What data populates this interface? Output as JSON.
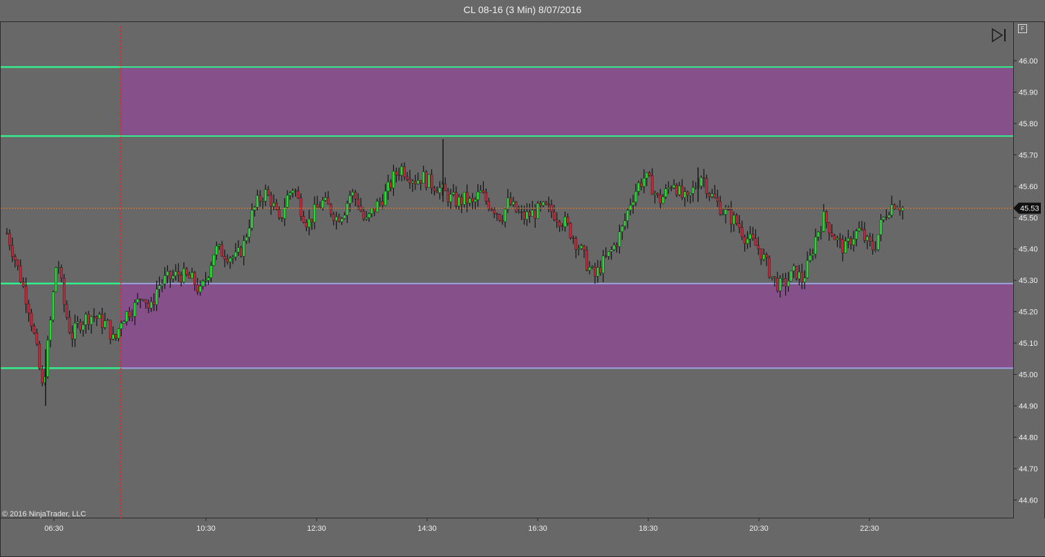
{
  "window": {
    "title": "CL 08-16 (3 Min)  8/07/2016"
  },
  "copyright": "© 2016 NinjaTrader, LLC",
  "buttons": {
    "f_label": "F"
  },
  "icons": [
    "skip-to-end-icon"
  ],
  "colors": {
    "background": "#686868",
    "up_bar": "#1ee02d",
    "down_bar": "#c0283a",
    "wick": "#111111",
    "zone_fill": "#86508a",
    "zone_line": "#32f08c",
    "price_line": "#e07a2c",
    "session_line": "#c83232"
  },
  "chart_data": {
    "type": "candlestick",
    "title": "CL 08-16 (3 Min)  8/07/2016",
    "y_ticks": [
      "46.00",
      "45.90",
      "45.80",
      "45.70",
      "45.60",
      "45.50",
      "45.40",
      "45.30",
      "45.20",
      "45.10",
      "45.00",
      "44.90",
      "44.80",
      "44.70",
      "44.60"
    ],
    "ylim": [
      44.55,
      46.14
    ],
    "x_ticks": [
      "06:30",
      "10:30",
      "12:30",
      "14:30",
      "16:30",
      "18:30",
      "20:30",
      "22:30"
    ],
    "last_price_label": "45.53",
    "last_price": 45.53,
    "zones": [
      {
        "top": 45.98,
        "bottom": 45.76
      },
      {
        "top": 45.29,
        "bottom": 45.02
      }
    ],
    "session_break_time": "08:55",
    "ohlc_close_path": [
      45.45,
      45.38,
      45.3,
      45.22,
      45.1,
      44.95,
      45.15,
      45.38,
      45.22,
      45.12,
      45.16,
      45.18,
      45.19,
      45.17,
      45.16,
      45.1,
      45.18,
      45.2,
      45.22,
      45.26,
      45.2,
      45.28,
      45.3,
      45.31,
      45.32,
      45.31,
      45.3,
      45.26,
      45.32,
      45.4,
      45.39,
      45.38,
      45.37,
      45.41,
      45.5,
      45.55,
      45.58,
      45.55,
      45.48,
      45.56,
      45.6,
      45.53,
      45.48,
      45.52,
      45.55,
      45.53,
      45.5,
      45.52,
      45.58,
      45.55,
      45.48,
      45.52,
      45.55,
      45.58,
      45.63,
      45.66,
      45.64,
      45.62,
      45.63,
      45.61,
      45.6,
      45.58,
      45.56,
      45.55,
      45.56,
      45.54,
      45.58,
      45.55,
      45.53,
      45.5,
      45.55,
      45.52,
      45.5,
      45.51,
      45.52,
      45.53,
      45.52,
      45.5,
      45.48,
      45.44,
      45.4,
      45.35,
      45.31,
      45.35,
      45.38,
      45.42,
      45.47,
      45.55,
      45.6,
      45.63,
      45.6,
      45.55,
      45.58,
      45.62,
      45.57,
      45.55,
      45.6,
      45.64,
      45.58,
      45.55,
      45.52,
      45.5,
      45.48,
      45.44,
      45.42,
      45.4,
      45.35,
      45.3,
      45.28,
      45.3,
      45.33,
      45.3,
      45.36,
      45.45,
      45.5,
      45.46,
      45.42,
      45.4,
      45.44,
      45.46,
      45.42,
      45.4,
      45.48,
      45.53,
      45.55,
      45.53
    ]
  }
}
